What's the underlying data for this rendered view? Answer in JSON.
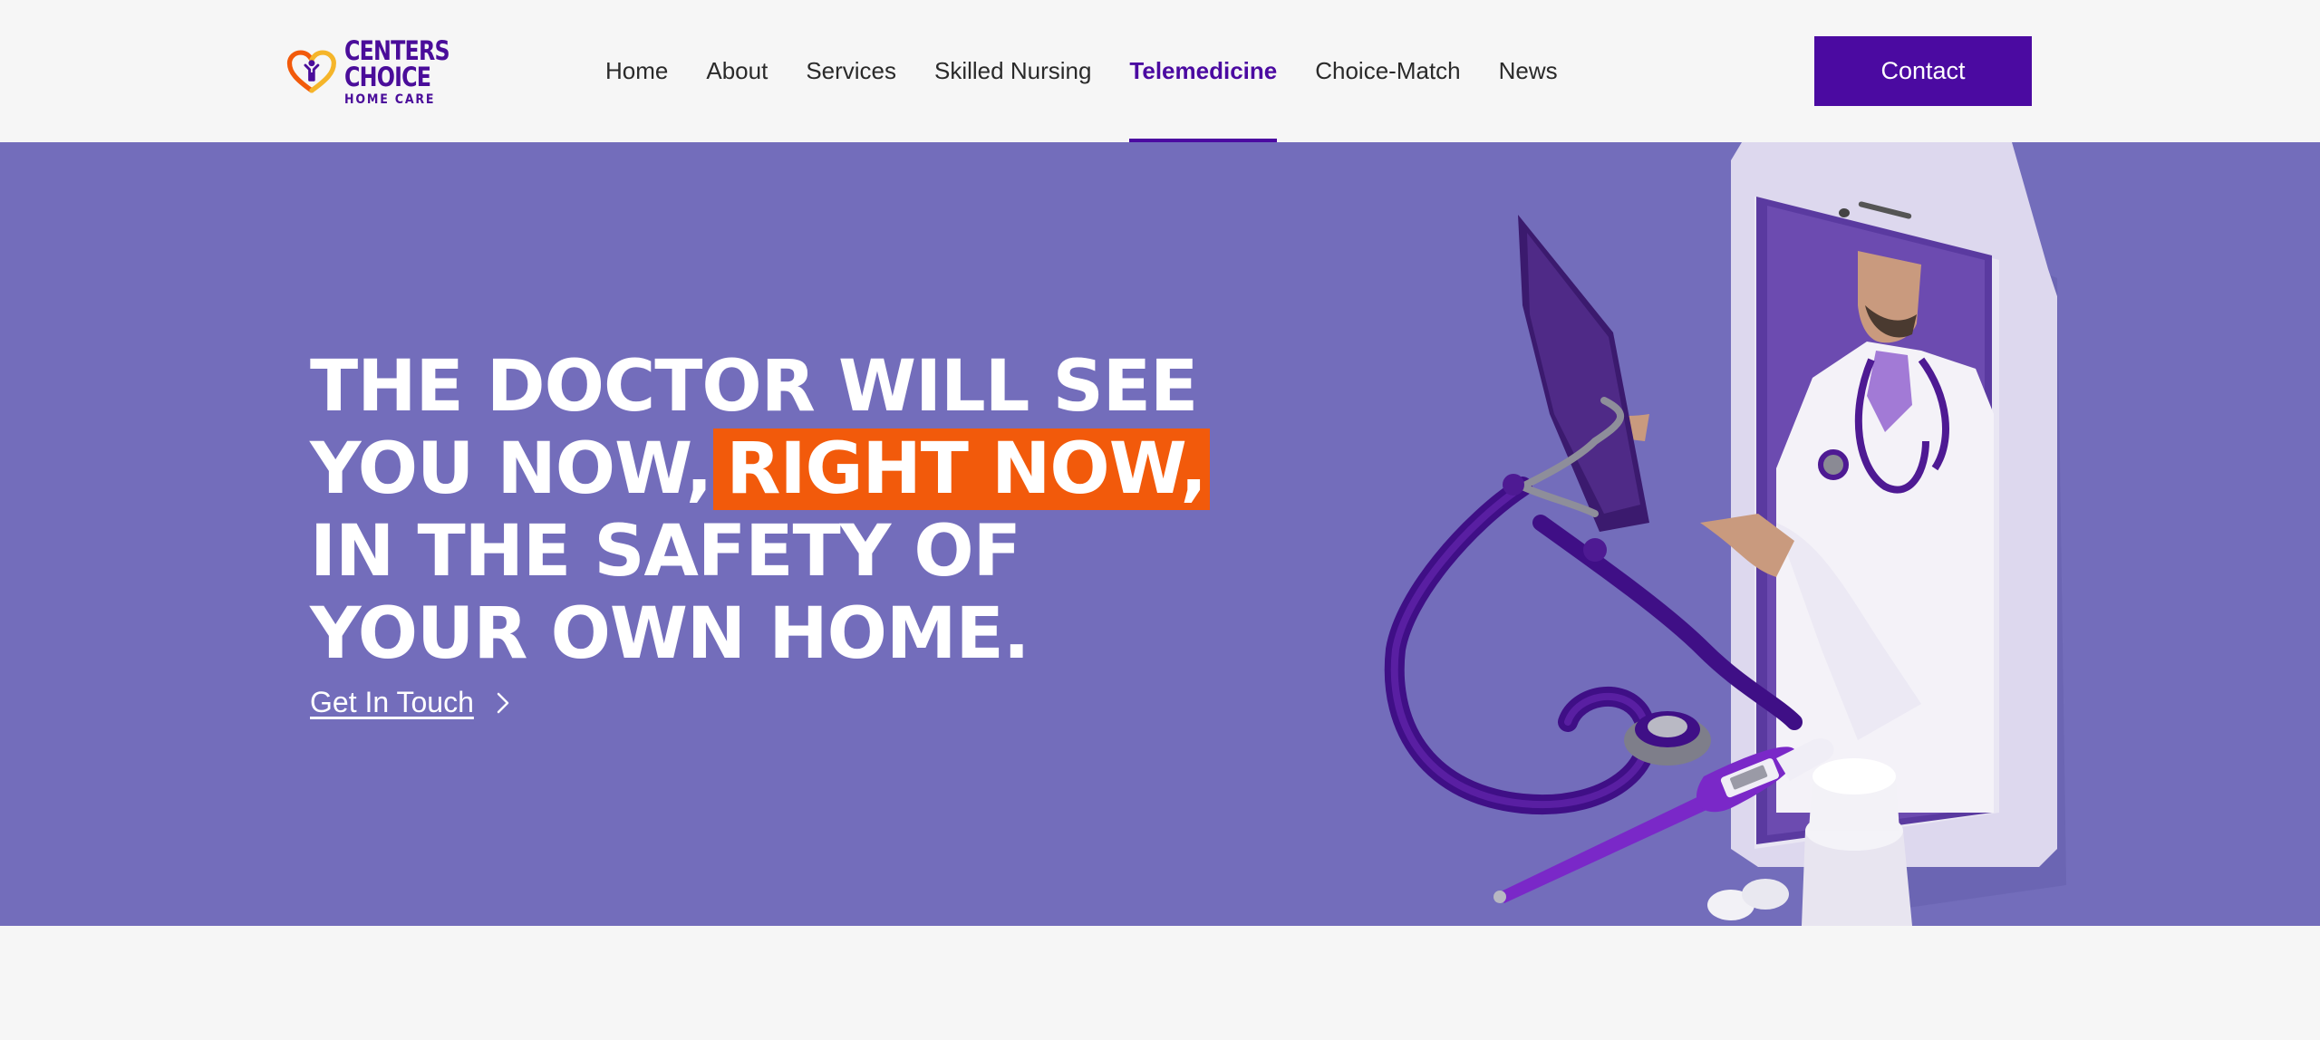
{
  "brand": {
    "logo_line1": "CENTERS",
    "logo_line2": "CHOICE",
    "logo_line3": "HOME CARE",
    "primary_color": "#4b0aa1",
    "accent_color": "#f25a0b",
    "hero_bg": "#736dbb"
  },
  "nav": {
    "items": [
      {
        "label": "Home",
        "active": false
      },
      {
        "label": "About",
        "active": false
      },
      {
        "label": "Services",
        "active": false
      },
      {
        "label": "Skilled Nursing",
        "active": false
      },
      {
        "label": "Telemedicine",
        "active": true
      },
      {
        "label": "Choice-Match",
        "active": false
      },
      {
        "label": "News",
        "active": false
      }
    ],
    "contact_label": "Contact"
  },
  "hero": {
    "line1": "THE DOCTOR WILL SEE",
    "line2_plain": "YOU NOW,",
    "line2_highlight": "RIGHT NOW,",
    "line3": "IN THE SAFETY OF",
    "line4": "YOUR OWN HOME.",
    "cta_label": "Get In Touch",
    "cta_icon": "chevron-right-icon",
    "image_subject": "doctor-in-tablet-with-stethoscope-thermometer-pills"
  }
}
